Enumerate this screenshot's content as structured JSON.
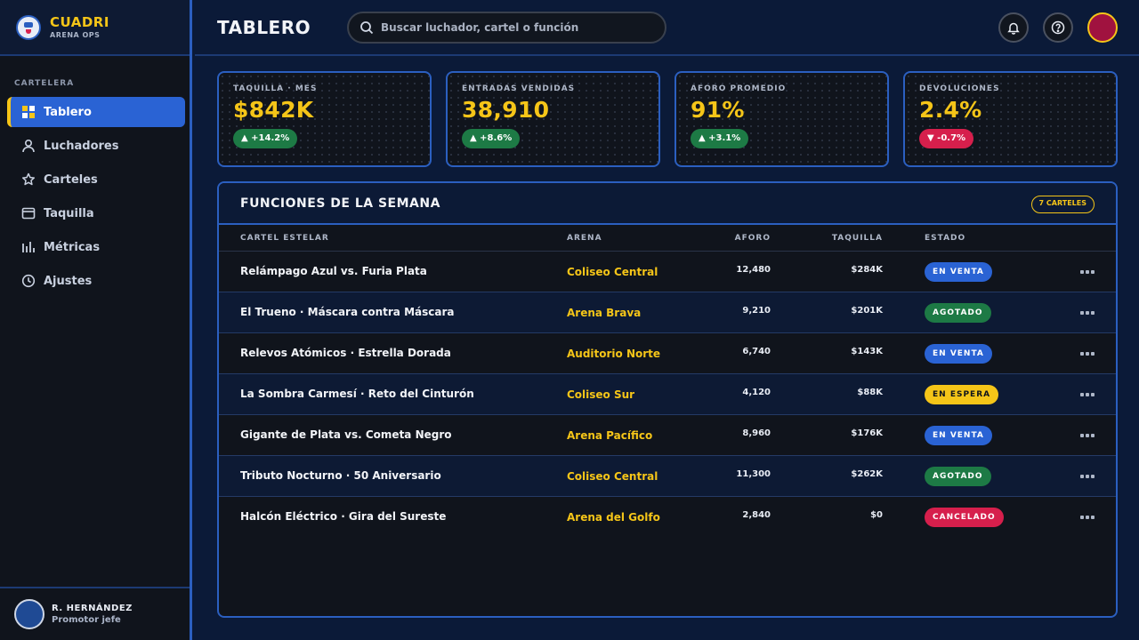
{
  "brand": {
    "name": "CUADRI",
    "subtitle": "ARENA OPS"
  },
  "sidebar": {
    "section_label": "CARTELERA",
    "items": [
      {
        "label": "Tablero",
        "icon": "dashboard-icon",
        "active": true
      },
      {
        "label": "Luchadores",
        "icon": "user-icon",
        "active": false
      },
      {
        "label": "Carteles",
        "icon": "star-icon",
        "active": false
      },
      {
        "label": "Taquilla",
        "icon": "ticket-icon",
        "active": false
      },
      {
        "label": "Métricas",
        "icon": "bar-chart-icon",
        "active": false
      },
      {
        "label": "Ajustes",
        "icon": "clock-icon",
        "active": false
      }
    ]
  },
  "user": {
    "name": "R. HERNÁNDEZ",
    "role": "Promotor jefe"
  },
  "header": {
    "title": "TABLERO",
    "search_placeholder": "Buscar luchador, cartel o función"
  },
  "kpis": [
    {
      "label": "TAQUILLA · MES",
      "value": "$842K",
      "delta": "▲ +14.2%",
      "trend": "up"
    },
    {
      "label": "ENTRADAS VENDIDAS",
      "value": "38,910",
      "delta": "▲ +8.6%",
      "trend": "up"
    },
    {
      "label": "AFORO PROMEDIO",
      "value": "91%",
      "delta": "▲ +3.1%",
      "trend": "up"
    },
    {
      "label": "DEVOLUCIONES",
      "value": "2.4%",
      "delta": "▼ -0.7%",
      "trend": "down"
    }
  ],
  "table": {
    "title": "FUNCIONES DE LA SEMANA",
    "count_pill": "7 CARTELES",
    "columns": [
      "CARTEL ESTELAR",
      "ARENA",
      "AFORO",
      "TAQUILLA",
      "ESTADO"
    ],
    "rows": [
      {
        "cartel": "Relámpago Azul vs. Furia Plata",
        "arena": "Coliseo Central",
        "aforo": "12,480",
        "taquilla": "$284K",
        "estado": "EN VENTA",
        "status": "venta"
      },
      {
        "cartel": "El Trueno · Máscara contra Máscara",
        "arena": "Arena Brava",
        "aforo": "9,210",
        "taquilla": "$201K",
        "estado": "AGOTADO",
        "status": "agotado"
      },
      {
        "cartel": "Relevos Atómicos · Estrella Dorada",
        "arena": "Auditorio Norte",
        "aforo": "6,740",
        "taquilla": "$143K",
        "estado": "EN VENTA",
        "status": "venta"
      },
      {
        "cartel": "La Sombra Carmesí · Reto del Cinturón",
        "arena": "Coliseo Sur",
        "aforo": "4,120",
        "taquilla": "$88K",
        "estado": "EN ESPERA",
        "status": "espera"
      },
      {
        "cartel": "Gigante de Plata vs. Cometa Negro",
        "arena": "Arena Pacífico",
        "aforo": "8,960",
        "taquilla": "$176K",
        "estado": "EN VENTA",
        "status": "venta"
      },
      {
        "cartel": "Tributo Nocturno · 50 Aniversario",
        "arena": "Coliseo Central",
        "aforo": "11,300",
        "taquilla": "$262K",
        "estado": "AGOTADO",
        "status": "agotado"
      },
      {
        "cartel": "Halcón Eléctrico · Gira del Sureste",
        "arena": "Arena del Golfo",
        "aforo": "2,840",
        "taquilla": "$0",
        "estado": "CANCELADO",
        "status": "cancelado"
      }
    ]
  },
  "colors": {
    "accent": "#f5c518",
    "primary": "#2a63d4",
    "success": "#1d7a45",
    "danger": "#d61f4c"
  }
}
